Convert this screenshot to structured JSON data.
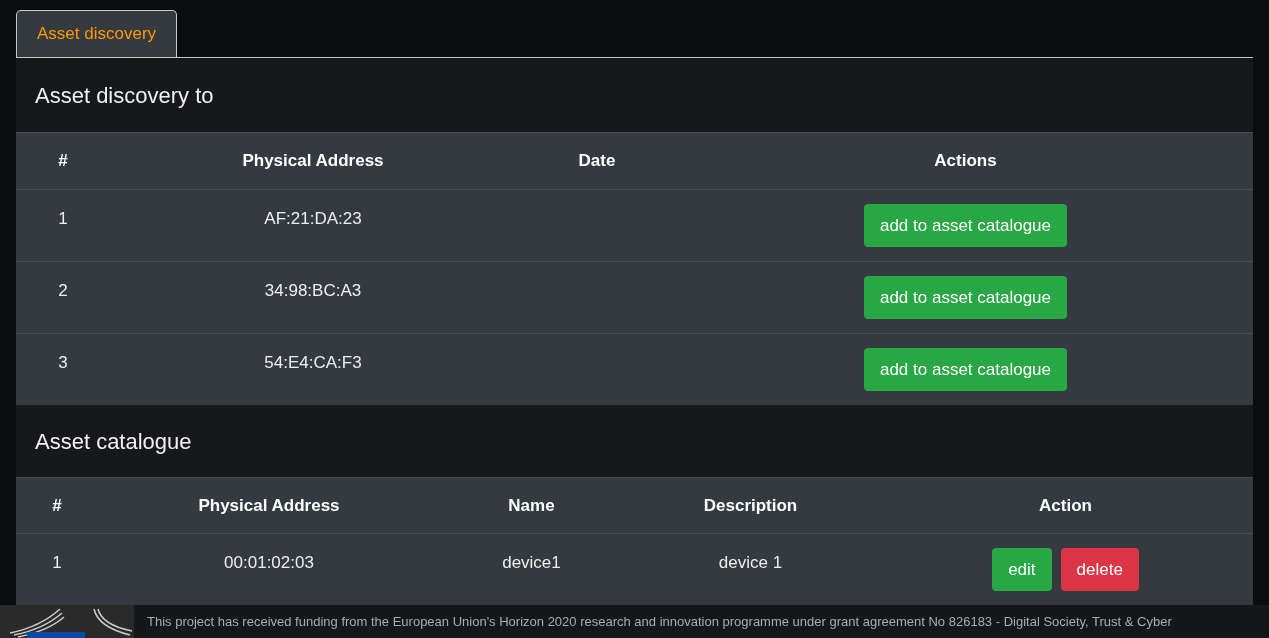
{
  "tabs": [
    {
      "label": "Asset discovery",
      "selected": true
    }
  ],
  "discovery": {
    "title": "Asset discovery to",
    "columns": [
      "#",
      "Physical Address",
      "Date",
      "Actions"
    ],
    "rows": [
      {
        "index": "1",
        "address": "AF:21:DA:23",
        "date": "",
        "action": "add to asset catalogue"
      },
      {
        "index": "2",
        "address": "34:98:BC:A3",
        "date": "",
        "action": "add to asset catalogue"
      },
      {
        "index": "3",
        "address": "54:E4:CA:F3",
        "date": "",
        "action": "add to asset catalogue"
      }
    ]
  },
  "catalogue": {
    "title": "Asset catalogue",
    "columns": [
      "#",
      "Physical Address",
      "Name",
      "Description",
      "Action"
    ],
    "rows": [
      {
        "index": "1",
        "address": "00:01:02:03",
        "name": "device1",
        "description": "device 1",
        "edit": "edit",
        "delete": "delete"
      }
    ]
  },
  "footer": {
    "text": "This project has received funding from the European Union's Horizon 2020 research and innovation programme under grant agreement No 826183 - Digital Society, Trust & Cyber"
  }
}
